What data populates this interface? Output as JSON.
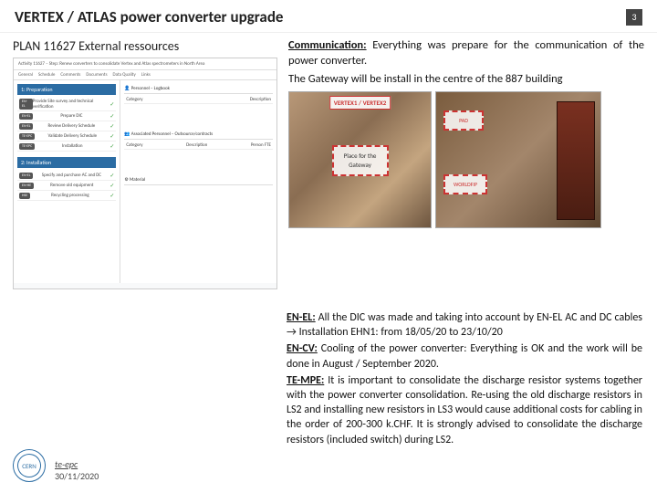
{
  "header": {
    "title": "VERTEX / ATLAS power converter upgrade",
    "page_number": "3"
  },
  "left": {
    "subtitle": "PLAN 11627 External ressources",
    "plan_header": "Activity 11627 – Step: Renew converters to consolidate Vertex and Atlas spectrometers in North Area",
    "tabs": [
      "General",
      "Schedule",
      "Comments",
      "Documents",
      "Data Quality",
      "Links"
    ],
    "section1": "1: Preparation",
    "section2": "2: Installation",
    "rows_left": [
      "Provide Site survey and technical verification",
      "Prepare DIC",
      "Review Delivery Schedule",
      "Validate Delivery Schedule",
      "Installation"
    ],
    "rows_right": [
      "Specify and purchase AC and DC",
      "Remove old equipment",
      "Recycling processing"
    ],
    "right_head1": "Personnel – Logbook",
    "right_head2": "Associated Personnel – Outsource/contracts",
    "right_head3": "Material",
    "col_cat": "Category",
    "col_desc": "Description",
    "col_person": "Person FTE"
  },
  "right": {
    "comm_label": "Communication:",
    "comm_text_1": " Everything was prepare for the communication of the power converter.",
    "comm_text_2": "The Gateway will be install in the centre of the 887 building",
    "photo_labels": {
      "vertex": "VERTEX1 / VERTEX2",
      "gateway": "Place for the Gateway",
      "pad": "PAD",
      "worldfip": "WORLDFIP"
    }
  },
  "lower": {
    "enel_label": "EN-EL:",
    "enel_text": " All the DIC was made and taking into account by EN-EL AC and DC cables → Installation EHN1: from 18/05/20 to 23/10/20",
    "encv_label": "EN-CV:",
    "encv_text": " Cooling of the power converter: Everything is OK and the work will be done in August / September 2020.",
    "tempe_label": "TE-MPE:",
    "tempe_text": " It is important to consolidate the discharge resistor systems together with the power converter consolidation. Re-using the old discharge resistors in LS2 and installing new resistors in LS3 would cause additional costs for cabling in the order of 200-300 k.CHF. It is strongly advised to consolidate the discharge resistors (included switch) during LS2."
  },
  "footer": {
    "logo_text": "CERN",
    "dept": "te-epc",
    "date": "30/11/2020"
  }
}
